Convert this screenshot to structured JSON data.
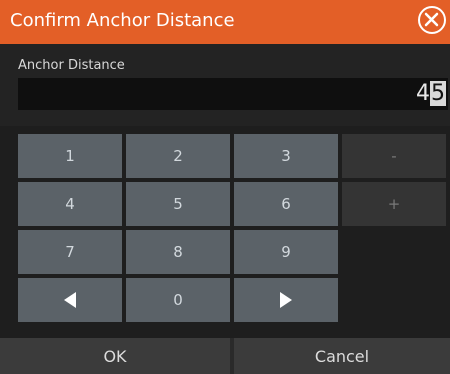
{
  "dialog": {
    "title": "Confirm Anchor Distance",
    "close_icon": "close-circle-icon",
    "field_label": "Anchor Distance",
    "value_prefix": "4",
    "value_selected": "5"
  },
  "keypad": {
    "keys": [
      "1",
      "2",
      "3",
      "-",
      "4",
      "5",
      "6",
      "+",
      "7",
      "8",
      "9",
      "0"
    ],
    "left_icon": "triangle-left-icon",
    "right_icon": "triangle-right-icon"
  },
  "footer": {
    "ok_label": "OK",
    "cancel_label": "Cancel"
  },
  "colors": {
    "accent": "#e35f27",
    "key": "#5b6268",
    "background": "#232323"
  }
}
